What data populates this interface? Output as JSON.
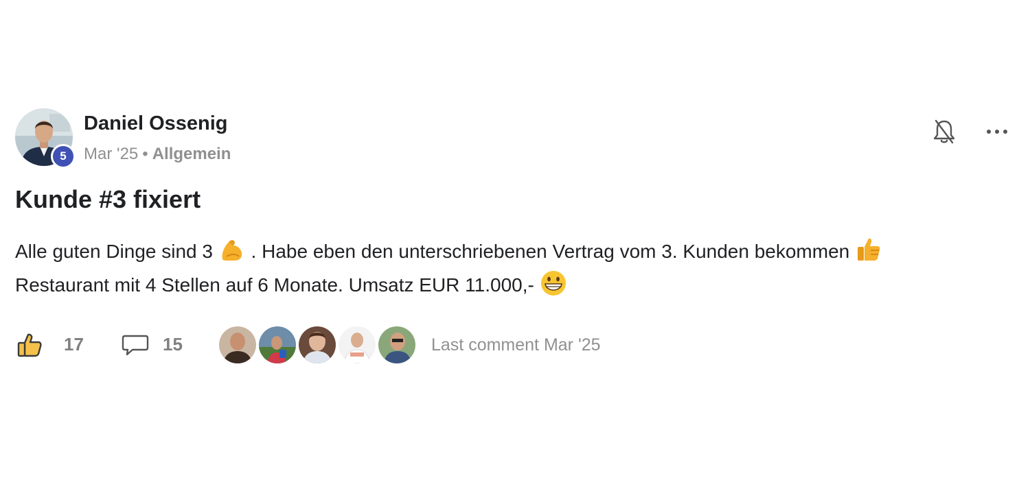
{
  "post": {
    "author": {
      "name": "Daniel Ossenig",
      "level": "5"
    },
    "meta": {
      "date": "Mar '25",
      "separator": "•",
      "category": "Allgemein"
    },
    "title": "Kunde #3 fixiert",
    "content": {
      "line1_part1": "Alle guten Dinge sind 3",
      "line1_emoji1": "flexed-biceps-emoji",
      "line1_part2": ". Habe eben den unterschriebenen Vertrag vom 3. Kunden bekommen",
      "line1_emoji2": "thumbs-up-emoji",
      "line2_part1": "Restaurant mit 4 Stellen auf 6 Monate. Umsatz EUR 11.000,-",
      "line2_emoji": "grinning-face-emoji"
    },
    "stats": {
      "likes": "17",
      "comments": "15",
      "last_comment": "Last comment Mar '25"
    },
    "icons": {
      "bell": "bell-off-icon",
      "more": "more-horizontal-icon",
      "like": "thumbs-up-icon",
      "comment": "comment-icon"
    },
    "colors": {
      "badge": "#3f51b5",
      "muted_text": "#909090",
      "text": "#202124"
    }
  }
}
